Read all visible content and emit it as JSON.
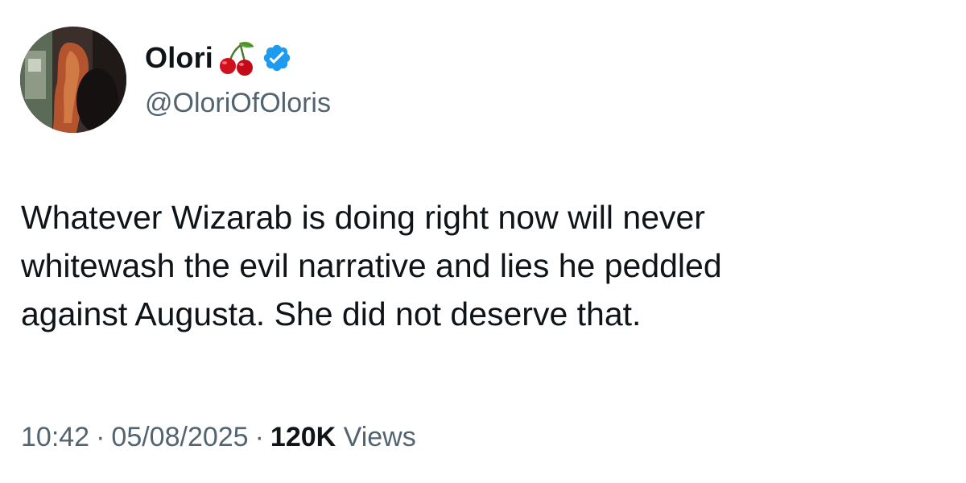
{
  "author": {
    "display_name": "Olori",
    "emoji": "cherries-emoji",
    "verified": true,
    "handle": "@OloriOfOloris"
  },
  "tweet": {
    "text_lines": [
      "Whatever Wizarab is doing right now will never",
      "whitewash the evil narrative and lies he peddled",
      "against Augusta. She did not deserve that."
    ]
  },
  "meta": {
    "time": "10:42",
    "date": "05/08/2025",
    "separator": "·",
    "views_count": "120K",
    "views_label": "Views"
  },
  "colors": {
    "text_primary": "#0f1419",
    "text_secondary": "#536471",
    "verified_blue": "#1d9bf0",
    "background": "#ffffff"
  }
}
